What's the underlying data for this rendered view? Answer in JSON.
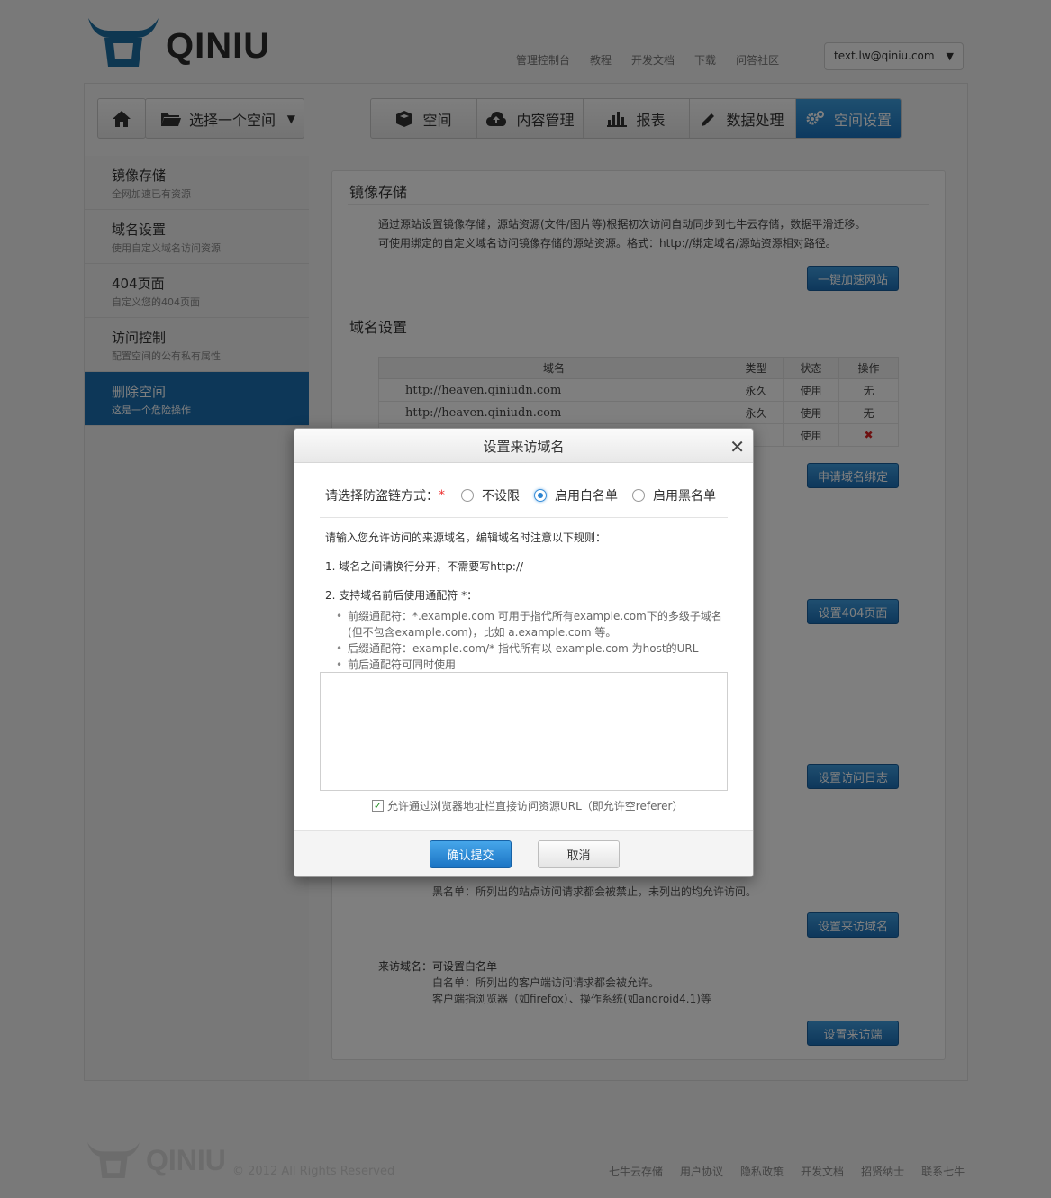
{
  "header": {
    "logo_text": "QINIU",
    "nav": [
      "管理控制台",
      "教程",
      "开发文档",
      "下载",
      "问答社区"
    ],
    "user_email": "text.lw@qiniu.com"
  },
  "toolbar": {
    "bucket_select": "选择一个空间",
    "tabs": [
      {
        "label": "空间",
        "icon": "cube-icon"
      },
      {
        "label": "内容管理",
        "icon": "cloud-upload-icon"
      },
      {
        "label": "报表",
        "icon": "bar-chart-icon"
      },
      {
        "label": "数据处理",
        "icon": "pencil-icon"
      },
      {
        "label": "空间设置",
        "icon": "gears-icon"
      }
    ]
  },
  "sidebar": {
    "items": [
      {
        "title": "镜像存储",
        "sub": "全网加速已有资源"
      },
      {
        "title": "域名设置",
        "sub": "使用自定义域名访问资源"
      },
      {
        "title": "404页面",
        "sub": "自定义您的404页面"
      },
      {
        "title": "访问控制",
        "sub": "配置空间的公有私有属性"
      },
      {
        "title": "删除空间",
        "sub": "这是一个危险操作"
      }
    ]
  },
  "content": {
    "mirror": {
      "title": "镜像存储",
      "desc1": "通过源站设置镜像存储，源站资源(文件/图片等)根据初次访问自动同步到七牛云存储，数据平滑迁移。",
      "desc2": "可使用绑定的自定义域名访问镜像存储的源站资源。格式：http://绑定域名/源站资源相对路径。",
      "button": "一键加速网站"
    },
    "domain": {
      "title": "域名设置",
      "headers": [
        "域名",
        "类型",
        "状态",
        "操作"
      ],
      "rows": [
        {
          "url": "http://heaven.qiniudn.com",
          "type": "永久",
          "status": "使用",
          "op": "无"
        },
        {
          "url": "http://heaven.qiniudn.com",
          "type": "永久",
          "status": "使用",
          "op": "无"
        },
        {
          "url": "",
          "type": "",
          "status": "使用",
          "op": "✖"
        }
      ],
      "button": "申请域名绑定"
    },
    "btn_404": "设置404页面",
    "btn_log": "设置访问日志",
    "blacklist_text": "黑名单：所列出的站点访问请求都会被禁止，未列出的均允许访问。",
    "btn_referer": "设置来访域名",
    "ua": {
      "title": "来访域名：可设置白名单",
      "line1": "白名单：所列出的客户端访问请求都会被允许。",
      "line2": "客户端指浏览器（如firefox）、操作系统(如android4.1)等"
    },
    "btn_ua": "设置来访端"
  },
  "footer": {
    "logo_text": "QINIU",
    "copyright": "© 2012 All Rights Reserved",
    "links": [
      "七牛云存储",
      "用户协议",
      "隐私政策",
      "开发文档",
      "招贤纳士",
      "联系七牛"
    ]
  },
  "modal": {
    "title": "设置来访域名",
    "close": "✕",
    "label": "请选择防盗链方式：",
    "required": "*",
    "options": [
      "不设限",
      "启用白名单",
      "启用黑名单"
    ],
    "selected_index": 1,
    "intro": "请输入您允许访问的来源域名，编辑域名时注意以下规则：",
    "rule1": "1. 域名之间请换行分开，不需要写http://",
    "rule2": "2. 支持域名前后使用通配符 *：",
    "bullets": [
      "前缀通配符：*.example.com 可用于指代所有example.com下的多级子域名",
      "(但不包含example.com)，比如 a.example.com 等。",
      "后缀通配符：example.com/* 指代所有以 example.com 为host的URL",
      "前后通配符可同时使用"
    ],
    "textarea_value": "",
    "allow_empty_referer": "允许通过浏览器地址栏直接访问资源URL（即允许空referer）",
    "allow_checked": true,
    "ok": "确认提交",
    "cancel": "取消"
  }
}
